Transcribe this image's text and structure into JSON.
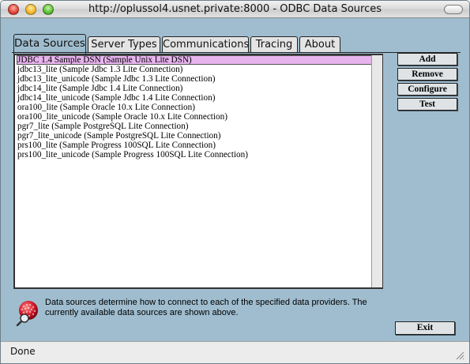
{
  "window": {
    "title": "http://oplussol4.usnet.private:8000 - ODBC Data Sources"
  },
  "tabs": [
    {
      "label": "Data Sources",
      "active": true
    },
    {
      "label": "Server Types",
      "active": false
    },
    {
      "label": "Communications",
      "active": false
    },
    {
      "label": "Tracing",
      "active": false
    },
    {
      "label": "About",
      "active": false
    }
  ],
  "data_sources": [
    "JDBC 1.4 Sample DSN (Sample Unix Lite DSN)",
    "jdbc13_lite (Sample Jdbc 1.3 Lite Connection)",
    "jdbc13_lite_unicode (Sample Jdbc 1.3 Lite Connection)",
    "jdbc14_lite (Sample Jdbc 1.4 Lite Connection)",
    "jdbc14_lite_unicode (Sample Jdbc 1.4 Lite Connection)",
    "ora100_lite (Sample Oracle 10.x Lite Connection)",
    "ora100_lite_unicode (Sample Oracle 10.x Lite Connection)",
    "pgr7_lite (Sample PostgreSQL Lite Connection)",
    "pgr7_lite_unicode (Sample PostgreSQL Lite Connection)",
    "prs100_lite (Sample Progress 100SQL Lite Connection)",
    "prs100_lite_unicode (Sample Progress 100SQL Lite Connection)"
  ],
  "selected_index": 0,
  "buttons": {
    "add": "Add",
    "remove": "Remove",
    "configure": "Configure",
    "test": "Test",
    "exit": "Exit"
  },
  "info": {
    "text": "Data sources determine how to connect to each of the specified data providers. The currently available data sources are shown above.",
    "icon": "database-magnifier-icon"
  },
  "status": {
    "text": "Done"
  },
  "colors": {
    "window_bg": "#9fbdcf",
    "selection": "#e8b4ee",
    "tab_inactive": "#e4e4e4"
  }
}
